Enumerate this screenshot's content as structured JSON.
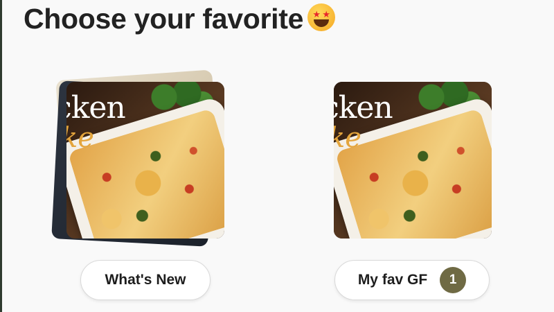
{
  "header": {
    "title": "Choose your favorite",
    "emoji": "star-struck-emoji-icon"
  },
  "cards": [
    {
      "image_text_main": "icken",
      "image_text_script": "ke",
      "button_label": "What's New"
    },
    {
      "image_text_main": "icken",
      "image_text_script": "ke",
      "button_label": "My fav GF",
      "badge_count": "1"
    }
  ],
  "colors": {
    "badge": "#6f6a44",
    "title": "#222222",
    "background": "#f9f9f9"
  }
}
